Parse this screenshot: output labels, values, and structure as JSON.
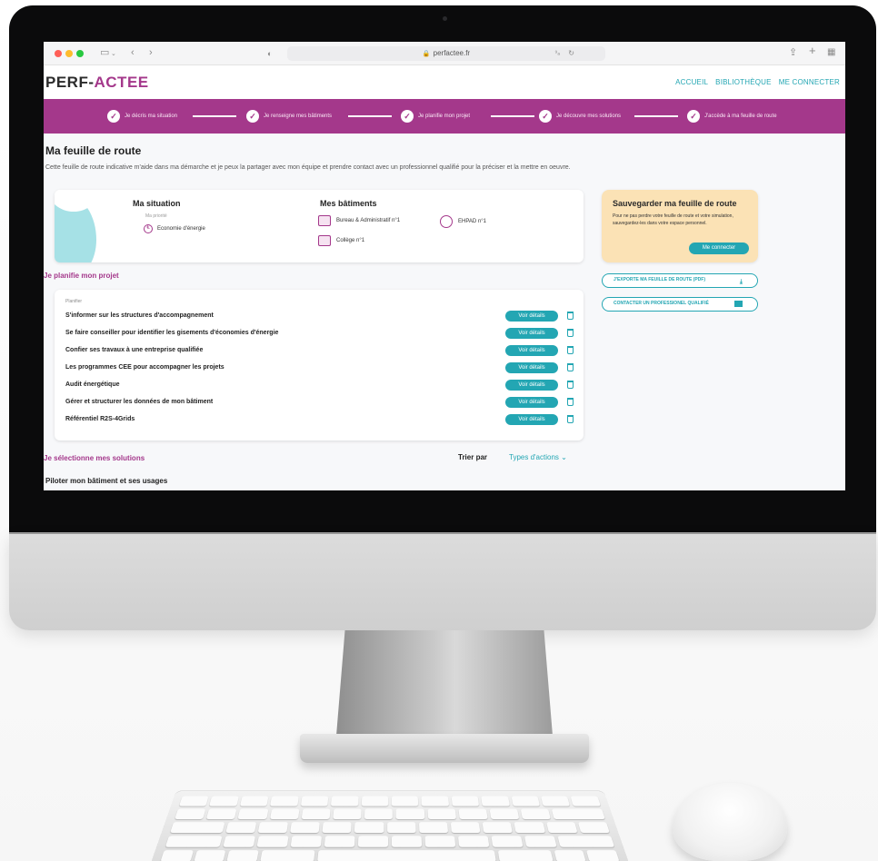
{
  "browser": {
    "url": "perfactee.fr"
  },
  "site": {
    "logo_prefix": "PERF-",
    "logo_accent": "ACTEE",
    "nav": [
      "ACCUEIL",
      "BIBLIOTHÈQUE",
      "ME CONNECTER"
    ],
    "steps": [
      "Je décris ma situation",
      "Je renseigne mes bâtiments",
      "Je planifie mon projet",
      "Je découvre mes solutions",
      "J'accède à ma feuille de route"
    ]
  },
  "page": {
    "title": "Ma feuille de route",
    "intro": "Cette feuille de route indicative m'aide dans ma démarche et je peux la partager avec mon équipe et prendre contact avec un professionnel qualifié pour la préciser et la mettre en oeuvre."
  },
  "situation": {
    "title": "Ma situation",
    "priority_label": "Ma priorité",
    "priority_value": "Economie d'énergie"
  },
  "buildings": {
    "title": "Mes bâtiments",
    "items": [
      "Bureau & Administratif n°1",
      "EHPAD n°1",
      "Collège n°1"
    ]
  },
  "save": {
    "title": "Sauvegarder ma feuille de route",
    "text": "Pour ne pas perdre votre feuille de route et votre simulation, sauvegardez-les dans votre espace personnel.",
    "button": "Me connecter"
  },
  "actions": {
    "export": "J'EXPORTE MA FEUILLE DE ROUTE (PDF)",
    "contact": "CONTACTER UN PROFESSIONEL QUALIFIÉ"
  },
  "plan": {
    "section_title": "Je planifie mon projet",
    "group_label": "Planifier",
    "details_label": "Voir détails",
    "items": [
      "S'informer sur les structures d'accompagnement",
      "Se faire conseiller pour identifier les gisements d'économies d'énergie",
      "Confier ses travaux à une entreprise qualifiée",
      "Les programmes CEE pour accompagner les projets",
      "Audit énergétique",
      "Gérer et structurer les données de mon bâtiment",
      "Référentiel R2S-4Grids"
    ]
  },
  "solutions": {
    "section_title": "Je sélectionne mes solutions",
    "sort_label": "Trier par",
    "sort_value": "Types d'actions ⌄",
    "first_group": "Piloter mon bâtiment et ses usages"
  },
  "colors": {
    "brand_purple": "#a4388b",
    "accent_teal": "#23a6b3",
    "save_card": "#fbe2b5"
  }
}
